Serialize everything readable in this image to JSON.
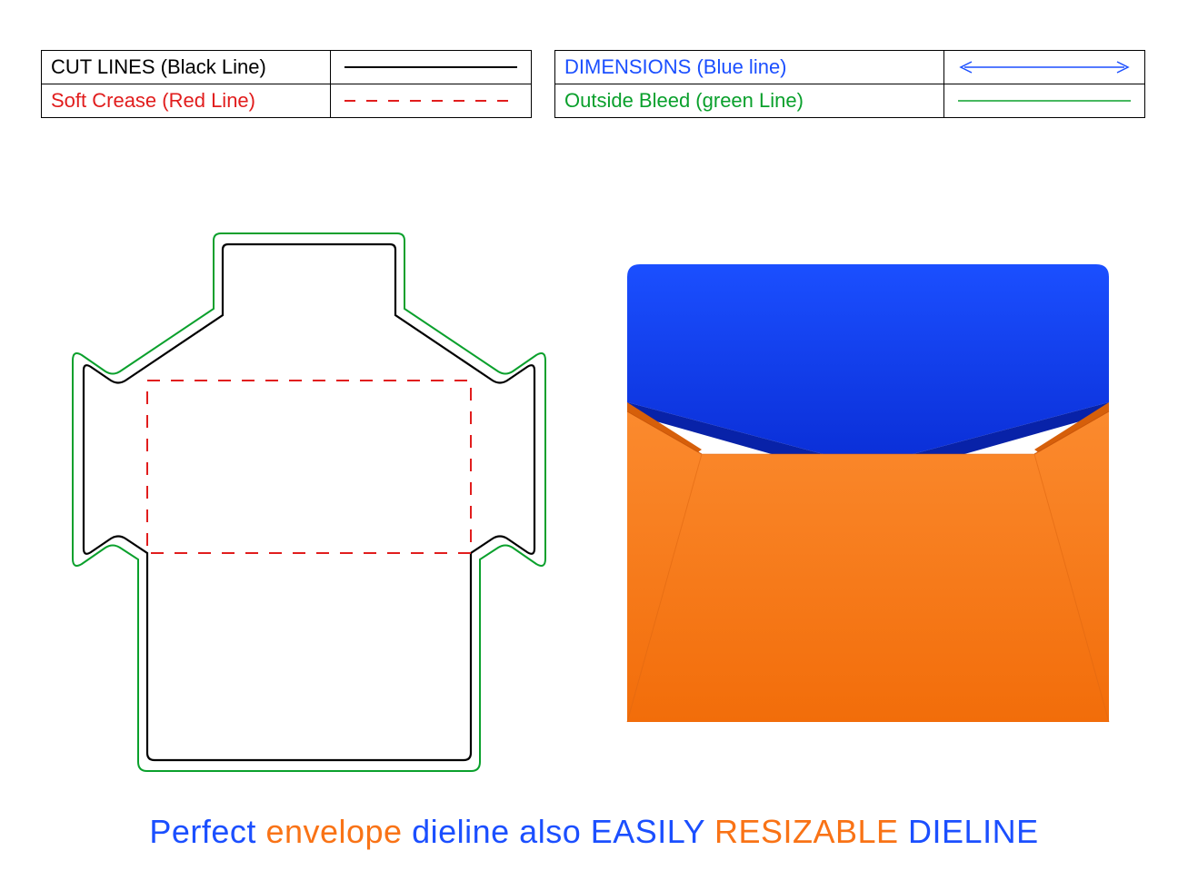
{
  "legend": {
    "left": {
      "row1": {
        "label": "CUT LINES (Black Line)",
        "color": "#000000"
      },
      "row2": {
        "label": "Soft Crease (Red Line)",
        "color": "#e11d1d"
      }
    },
    "right": {
      "row1": {
        "label": "DIMENSIONS (Blue line)",
        "color": "#1b4fff"
      },
      "row2": {
        "label": "Outside Bleed (green Line)",
        "color": "#0aa02c"
      }
    }
  },
  "tagline": {
    "w1": "Perfect ",
    "w2": "envelope ",
    "w3": "dieline also ",
    "w4": "EASILY ",
    "w5": "RESIZABLE ",
    "w6": "DIELINE"
  },
  "colors": {
    "envelope_body": "#f97316",
    "envelope_flap": "#1b4fff",
    "cut": "#000000",
    "crease": "#e11d1d",
    "bleed": "#0aa02c",
    "dimension": "#1b4fff"
  }
}
